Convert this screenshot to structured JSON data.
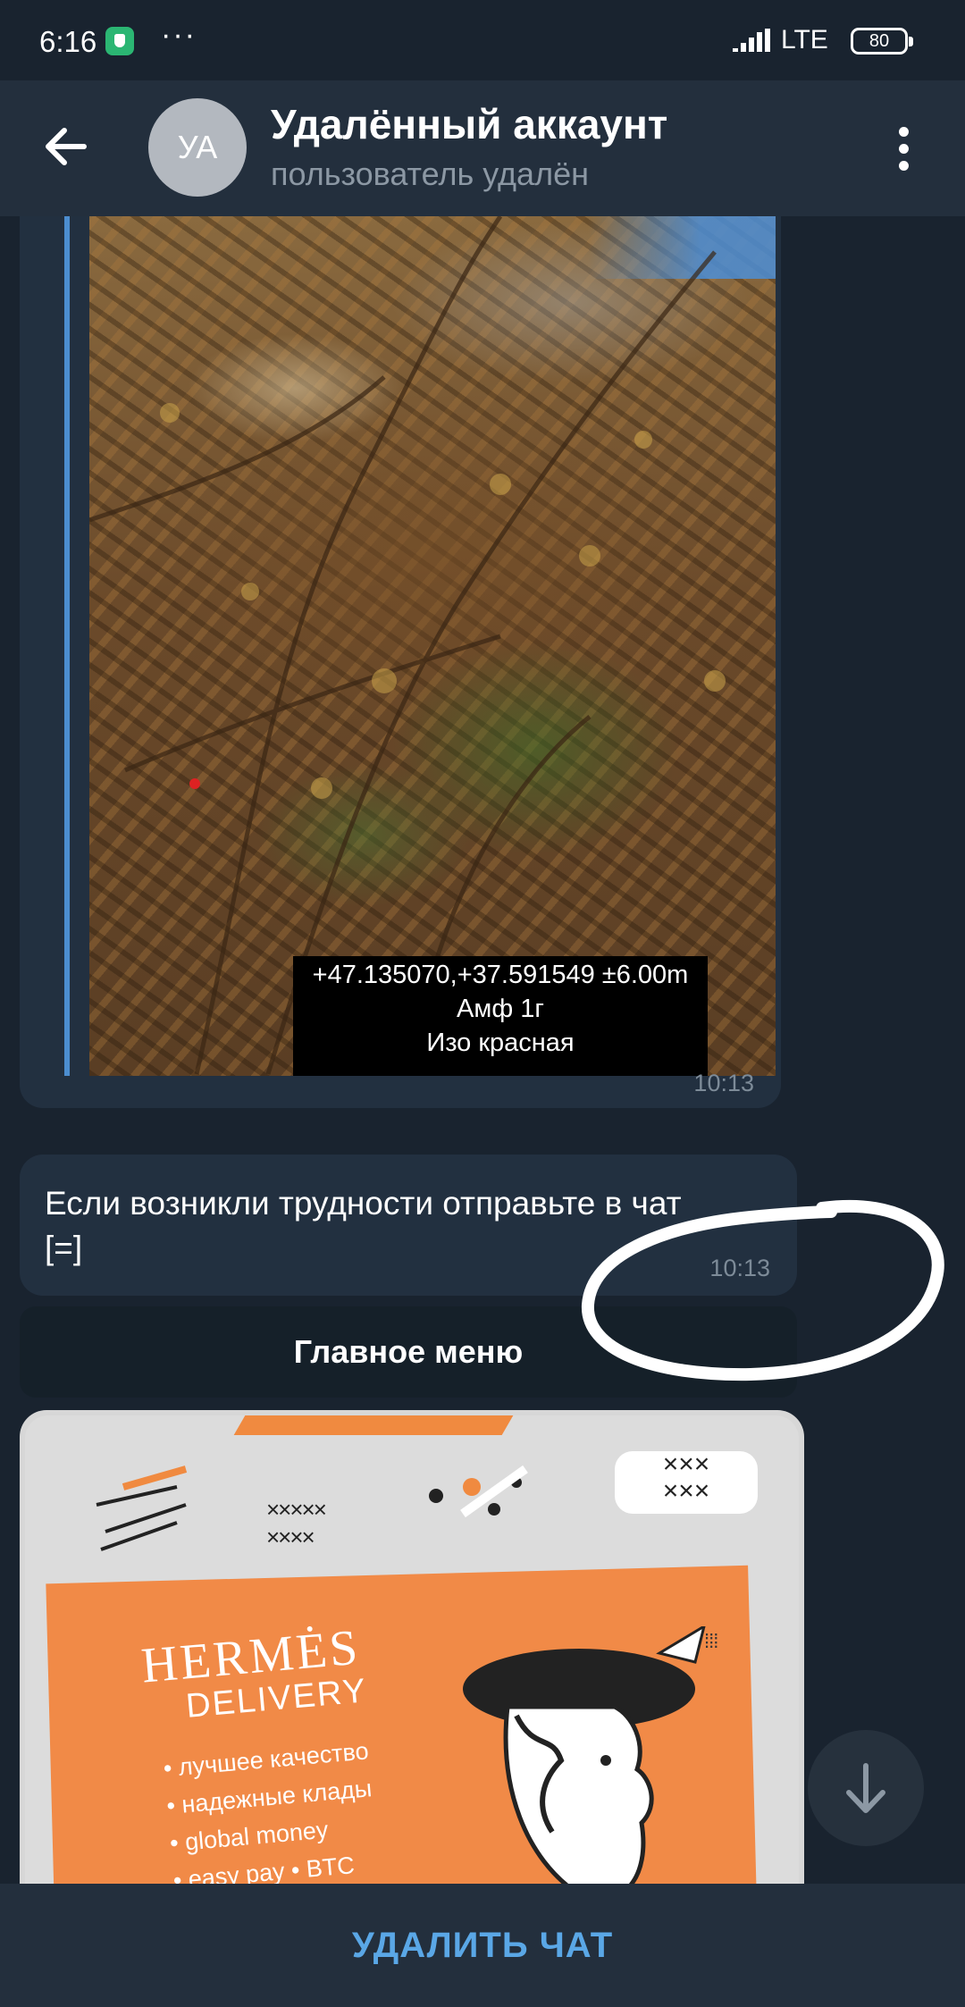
{
  "status_bar": {
    "time": "6:16",
    "menu": "···",
    "network": "LTE",
    "battery": "80"
  },
  "header": {
    "avatar_initials": "УА",
    "title": "Удалённый аккаунт",
    "subtitle": "пользователь удалён"
  },
  "messages": [
    {
      "type": "photo",
      "caption_lines": [
        "+47.135070,+37.591549 ±6.00m",
        "Амф 1г",
        "Изо красная"
      ],
      "time": "10:13"
    },
    {
      "type": "text",
      "text": "Если возникли трудности отправьте в чат\n[=]",
      "time": "10:13"
    }
  ],
  "keyboard": {
    "button_label": "Главное меню"
  },
  "promo": {
    "brand": "HERMĖS",
    "subtitle": "DELIVERY",
    "features": [
      "• лучшее качество",
      "• надежные клады",
      "• global money",
      "• easy pay  • BTC"
    ]
  },
  "bottom": {
    "action_label": "УДАЛИТЬ ЧАТ"
  },
  "colors": {
    "background": "#19232f",
    "header": "#232f3d",
    "bubble": "#223040",
    "accent": "#5aa7e6",
    "promo_orange": "#f18a47"
  }
}
